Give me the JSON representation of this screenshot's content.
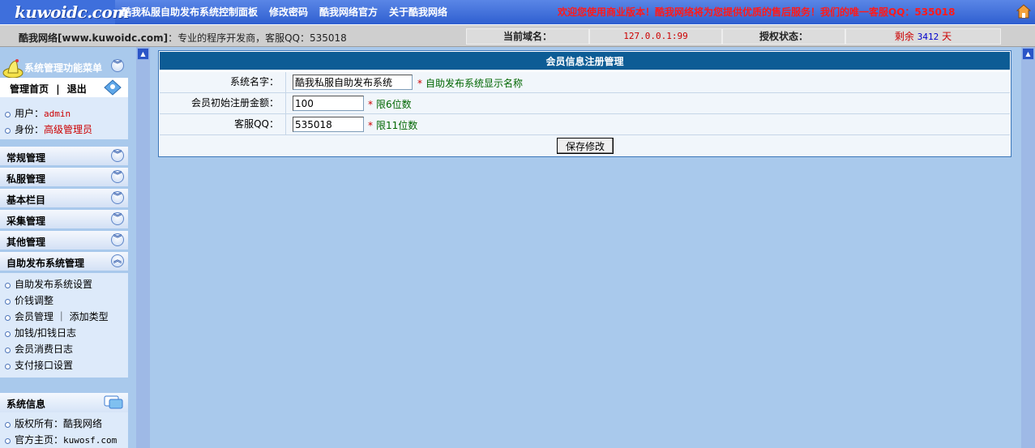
{
  "header": {
    "logo_text": "kuwoidc.com",
    "nav": [
      "酷我私服自助发布系统控制面板",
      "修改密码",
      "酷我网络官方",
      "关于酷我网络"
    ],
    "welcome": "欢迎您使用商业版本！酷我网络将为您提供优质的售后服务！我们的唯一客服QQ：535018"
  },
  "infobar": {
    "site_name": "酷我网络[www.kuwoidc.com]",
    "site_desc": "：专业的程序开发商，客服QQ：535018",
    "domain_label": "当前域名：",
    "domain_value": "127.0.0.1:99",
    "license_label": "授权状态：",
    "license_prefix": "剩余",
    "license_days": "3412",
    "license_suffix": "天"
  },
  "sidebar": {
    "menu_title": "系统管理功能菜单",
    "top_links": {
      "home": "管理首页",
      "sep": "|",
      "logout": "退出"
    },
    "user_label": "用户：",
    "user_value": "admin",
    "role_label": "身份：",
    "role_value": "高级管理员",
    "menus": [
      "常规管理",
      "私服管理",
      "基本栏目",
      "采集管理",
      "其他管理",
      "自助发布系统管理"
    ],
    "sub_items": [
      "自助发布系统设置",
      "价钱调整",
      "会员管理 ｜ 添加类型",
      "加钱/扣钱日志",
      "会员消费日志",
      "支付接口设置"
    ],
    "sysinfo_title": "系统信息",
    "copyright_label": "版权所有：",
    "copyright_value": "酷我网络",
    "homepage_label": "官方主页：",
    "homepage_value": "kuwosf.com"
  },
  "form": {
    "title": "会员信息注册管理",
    "fields": [
      {
        "label": "系统名字：",
        "value": "酷我私服自助发布系统",
        "hint": "自助发布系统显示名称"
      },
      {
        "label": "会员初始注册金额：",
        "value": "100",
        "hint": "限6位数"
      },
      {
        "label": "客服QQ：",
        "value": "535018",
        "hint": "限11位数"
      }
    ],
    "star": "*",
    "save_label": "保存修改"
  },
  "colors": {
    "topbar": "#3e6fdc",
    "panel_head": "#0d5c95",
    "background": "#a9c9ec",
    "accent_red": "#cc0000",
    "hint_green": "#006600"
  }
}
